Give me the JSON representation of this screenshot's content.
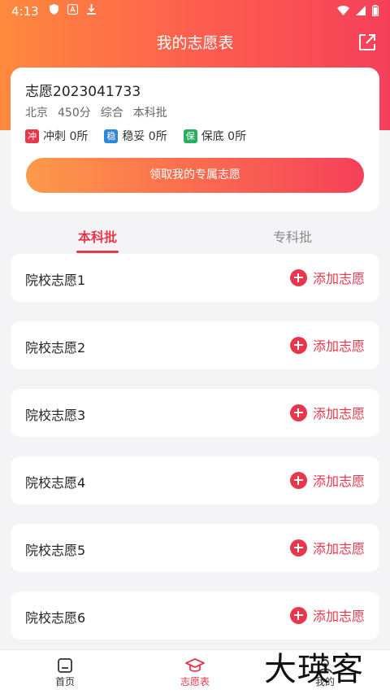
{
  "status_bar": {
    "time": "4:13"
  },
  "header": {
    "title": "我的志愿表"
  },
  "profile": {
    "name": "志愿2023041733",
    "meta": [
      "北京",
      "450分",
      "综合",
      "本科批"
    ],
    "badges": [
      {
        "tag": "冲",
        "label": "冲刺 0所",
        "color": "#e8374b"
      },
      {
        "tag": "稳",
        "label": "稳妥 0所",
        "color": "#2f86d6"
      },
      {
        "tag": "保",
        "label": "保底 0所",
        "color": "#27ae60"
      }
    ],
    "claim_button": "领取我的专属志愿"
  },
  "tabs": [
    {
      "label": "本科批",
      "active": true
    },
    {
      "label": "专科批",
      "active": false
    }
  ],
  "wishes": [
    {
      "label": "院校志愿1",
      "action": "添加志愿"
    },
    {
      "label": "院校志愿2",
      "action": "添加志愿"
    },
    {
      "label": "院校志愿3",
      "action": "添加志愿"
    },
    {
      "label": "院校志愿4",
      "action": "添加志愿"
    },
    {
      "label": "院校志愿5",
      "action": "添加志愿"
    },
    {
      "label": "院校志愿6",
      "action": "添加志愿"
    }
  ],
  "bottom_nav": [
    {
      "label": "首页",
      "icon": "home-icon"
    },
    {
      "label": "志愿表",
      "icon": "graduation-cap-icon",
      "active": true
    },
    {
      "label": "我的",
      "icon": "user-icon"
    }
  ],
  "watermark": "大瑛客",
  "colors": {
    "accent": "#e8374b",
    "gradient_start": "#ff8a3d",
    "gradient_end": "#f5405a"
  }
}
